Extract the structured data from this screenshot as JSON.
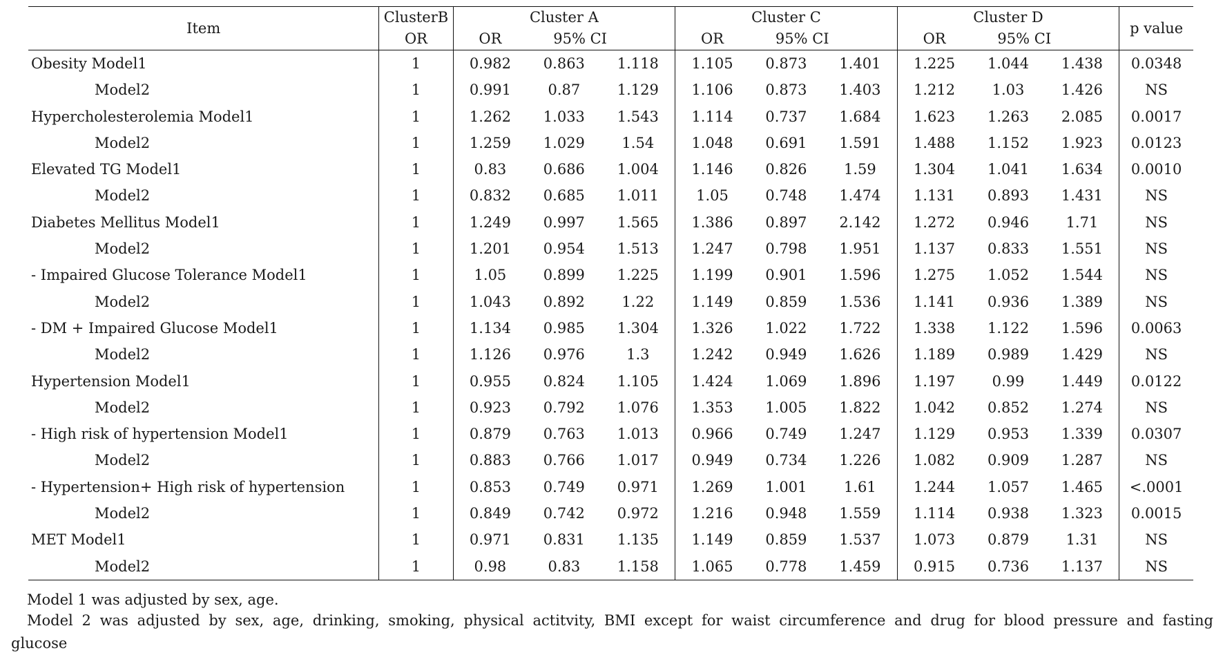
{
  "table": {
    "headers": {
      "item": "Item",
      "cluster_b": "ClusterB",
      "cluster_a": "Cluster  A",
      "cluster_c": "Cluster  C",
      "cluster_d": "Cluster  D",
      "p_value": "p  value",
      "or": "OR",
      "ci": "95%  CI"
    },
    "rows": [
      {
        "item": "Obesity  Model1",
        "sub": false,
        "b": "1",
        "a": [
          "0.982",
          "0.863",
          "1.118"
        ],
        "c": [
          "1.105",
          "0.873",
          "1.401"
        ],
        "d": [
          "1.225",
          "1.044",
          "1.438"
        ],
        "p": "0.0348"
      },
      {
        "item": "Model2",
        "sub": true,
        "b": "1",
        "a": [
          "0.991",
          "0.87",
          "1.129"
        ],
        "c": [
          "1.106",
          "0.873",
          "1.403"
        ],
        "d": [
          "1.212",
          "1.03",
          "1.426"
        ],
        "p": "NS"
      },
      {
        "item": "Hypercholesterolemia  Model1",
        "sub": false,
        "b": "1",
        "a": [
          "1.262",
          "1.033",
          "1.543"
        ],
        "c": [
          "1.114",
          "0.737",
          "1.684"
        ],
        "d": [
          "1.623",
          "1.263",
          "2.085"
        ],
        "p": "0.0017"
      },
      {
        "item": "Model2",
        "sub": true,
        "b": "1",
        "a": [
          "1.259",
          "1.029",
          "1.54"
        ],
        "c": [
          "1.048",
          "0.691",
          "1.591"
        ],
        "d": [
          "1.488",
          "1.152",
          "1.923"
        ],
        "p": "0.0123"
      },
      {
        "item": "Elevated  TG  Model1",
        "sub": false,
        "b": "1",
        "a": [
          "0.83",
          "0.686",
          "1.004"
        ],
        "c": [
          "1.146",
          "0.826",
          "1.59"
        ],
        "d": [
          "1.304",
          "1.041",
          "1.634"
        ],
        "p": "0.0010"
      },
      {
        "item": "Model2",
        "sub": true,
        "b": "1",
        "a": [
          "0.832",
          "0.685",
          "1.011"
        ],
        "c": [
          "1.05",
          "0.748",
          "1.474"
        ],
        "d": [
          "1.131",
          "0.893",
          "1.431"
        ],
        "p": "NS"
      },
      {
        "item": "Diabetes  Mellitus  Model1",
        "sub": false,
        "b": "1",
        "a": [
          "1.249",
          "0.997",
          "1.565"
        ],
        "c": [
          "1.386",
          "0.897",
          "2.142"
        ],
        "d": [
          "1.272",
          "0.946",
          "1.71"
        ],
        "p": "NS"
      },
      {
        "item": "Model2",
        "sub": true,
        "b": "1",
        "a": [
          "1.201",
          "0.954",
          "1.513"
        ],
        "c": [
          "1.247",
          "0.798",
          "1.951"
        ],
        "d": [
          "1.137",
          "0.833",
          "1.551"
        ],
        "p": "NS"
      },
      {
        "item": "-  Impaired  Glucose  Tolerance  Model1",
        "sub": false,
        "b": "1",
        "a": [
          "1.05",
          "0.899",
          "1.225"
        ],
        "c": [
          "1.199",
          "0.901",
          "1.596"
        ],
        "d": [
          "1.275",
          "1.052",
          "1.544"
        ],
        "p": "NS"
      },
      {
        "item": "Model2",
        "sub": true,
        "b": "1",
        "a": [
          "1.043",
          "0.892",
          "1.22"
        ],
        "c": [
          "1.149",
          "0.859",
          "1.536"
        ],
        "d": [
          "1.141",
          "0.936",
          "1.389"
        ],
        "p": "NS"
      },
      {
        "item": "-  DM  +  Impaired  Glucose  Model1",
        "sub": false,
        "b": "1",
        "a": [
          "1.134",
          "0.985",
          "1.304"
        ],
        "c": [
          "1.326",
          "1.022",
          "1.722"
        ],
        "d": [
          "1.338",
          "1.122",
          "1.596"
        ],
        "p": "0.0063"
      },
      {
        "item": "Model2",
        "sub": true,
        "b": "1",
        "a": [
          "1.126",
          "0.976",
          "1.3"
        ],
        "c": [
          "1.242",
          "0.949",
          "1.626"
        ],
        "d": [
          "1.189",
          "0.989",
          "1.429"
        ],
        "p": "NS"
      },
      {
        "item": "Hypertension  Model1",
        "sub": false,
        "b": "1",
        "a": [
          "0.955",
          "0.824",
          "1.105"
        ],
        "c": [
          "1.424",
          "1.069",
          "1.896"
        ],
        "d": [
          "1.197",
          "0.99",
          "1.449"
        ],
        "p": "0.0122"
      },
      {
        "item": "Model2",
        "sub": true,
        "b": "1",
        "a": [
          "0.923",
          "0.792",
          "1.076"
        ],
        "c": [
          "1.353",
          "1.005",
          "1.822"
        ],
        "d": [
          "1.042",
          "0.852",
          "1.274"
        ],
        "p": "NS"
      },
      {
        "item": "-  High  risk  of  hypertension  Model1",
        "sub": false,
        "b": "1",
        "a": [
          "0.879",
          "0.763",
          "1.013"
        ],
        "c": [
          "0.966",
          "0.749",
          "1.247"
        ],
        "d": [
          "1.129",
          "0.953",
          "1.339"
        ],
        "p": "0.0307"
      },
      {
        "item": "Model2",
        "sub": true,
        "b": "1",
        "a": [
          "0.883",
          "0.766",
          "1.017"
        ],
        "c": [
          "0.949",
          "0.734",
          "1.226"
        ],
        "d": [
          "1.082",
          "0.909",
          "1.287"
        ],
        "p": "NS"
      },
      {
        "item": "-  Hypertension+  High  risk  of  hypertension",
        "sub": false,
        "b": "1",
        "a": [
          "0.853",
          "0.749",
          "0.971"
        ],
        "c": [
          "1.269",
          "1.001",
          "1.61"
        ],
        "d": [
          "1.244",
          "1.057",
          "1.465"
        ],
        "p": "<.0001"
      },
      {
        "item": "Model2",
        "sub": true,
        "b": "1",
        "a": [
          "0.849",
          "0.742",
          "0.972"
        ],
        "c": [
          "1.216",
          "0.948",
          "1.559"
        ],
        "d": [
          "1.114",
          "0.938",
          "1.323"
        ],
        "p": "0.0015"
      },
      {
        "item": "MET  Model1",
        "sub": false,
        "b": "1",
        "a": [
          "0.971",
          "0.831",
          "1.135"
        ],
        "c": [
          "1.149",
          "0.859",
          "1.537"
        ],
        "d": [
          "1.073",
          "0.879",
          "1.31"
        ],
        "p": "NS"
      },
      {
        "item": "Model2",
        "sub": true,
        "b": "1",
        "a": [
          "0.98",
          "0.83",
          "1.158"
        ],
        "c": [
          "1.065",
          "0.778",
          "1.459"
        ],
        "d": [
          "0.915",
          "0.736",
          "1.137"
        ],
        "p": "NS"
      }
    ]
  },
  "footnotes": {
    "model1": "Model 1 was adjusted by sex, age.",
    "model2": "Model 2 was adjusted by sex, age, drinking, smoking, physical actitvity, BMI except for waist circumference and drug for blood pressure and fasting",
    "model2_cont": "glucose"
  }
}
